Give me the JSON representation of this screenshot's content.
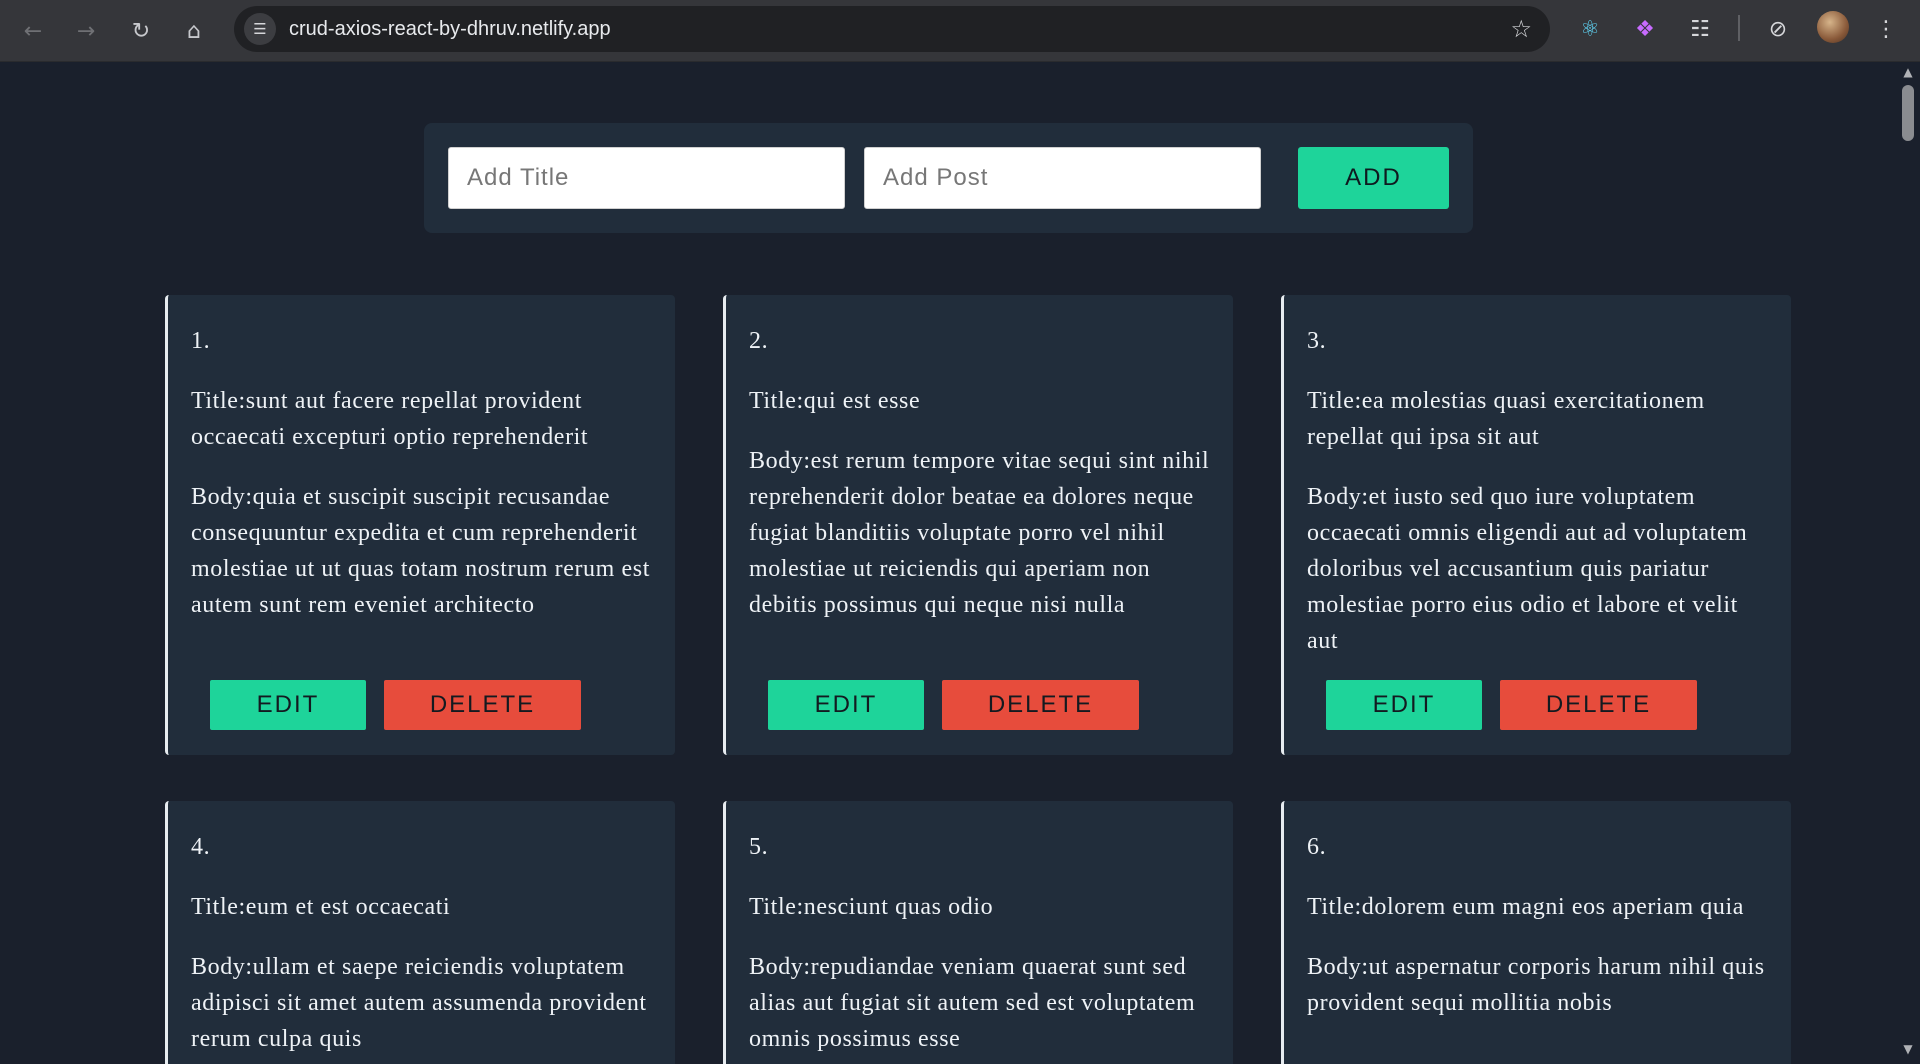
{
  "browser": {
    "url": "crud-axios-react-by-dhruv.netlify.app",
    "extensions": [
      "react-devtools-icon",
      "brain-extension-icon",
      "puzzle-extensions-icon",
      "performance-icon"
    ]
  },
  "form": {
    "title_placeholder": "Add Title",
    "post_placeholder": "Add Post",
    "add_label": "ADD"
  },
  "posts": [
    {
      "number": "1.",
      "title": "Title:sunt aut facere repellat provident occaecati excepturi optio reprehenderit",
      "body": "Body:quia et suscipit suscipit recusandae consequuntur expedita et cum reprehenderit molestiae ut ut quas totam nostrum rerum est autem sunt rem eveniet architecto",
      "edit_label": "EDIT",
      "delete_label": "DELETE"
    },
    {
      "number": "2.",
      "title": "Title:qui est esse",
      "body": "Body:est rerum tempore vitae sequi sint nihil reprehenderit dolor beatae ea dolores neque fugiat blanditiis voluptate porro vel nihil molestiae ut reiciendis qui aperiam non debitis possimus qui neque nisi nulla",
      "edit_label": "EDIT",
      "delete_label": "DELETE"
    },
    {
      "number": "3.",
      "title": "Title:ea molestias quasi exercitationem repellat qui ipsa sit aut",
      "body": "Body:et iusto sed quo iure voluptatem occaecati omnis eligendi aut ad voluptatem doloribus vel accusantium quis pariatur molestiae porro eius odio et labore et velit aut",
      "edit_label": "EDIT",
      "delete_label": "DELETE"
    },
    {
      "number": "4.",
      "title": "Title:eum et est occaecati",
      "body": "Body:ullam et saepe reiciendis voluptatem adipisci sit amet autem assumenda provident rerum culpa quis"
    },
    {
      "number": "5.",
      "title": "Title:nesciunt quas odio",
      "body": "Body:repudiandae veniam quaerat sunt sed alias aut fugiat sit autem sed est voluptatem omnis possimus esse"
    },
    {
      "number": "6.",
      "title": "Title:dolorem eum magni eos aperiam quia",
      "body": "Body:ut aspernatur corporis harum nihil quis provident sequi mollitia nobis"
    }
  ]
}
